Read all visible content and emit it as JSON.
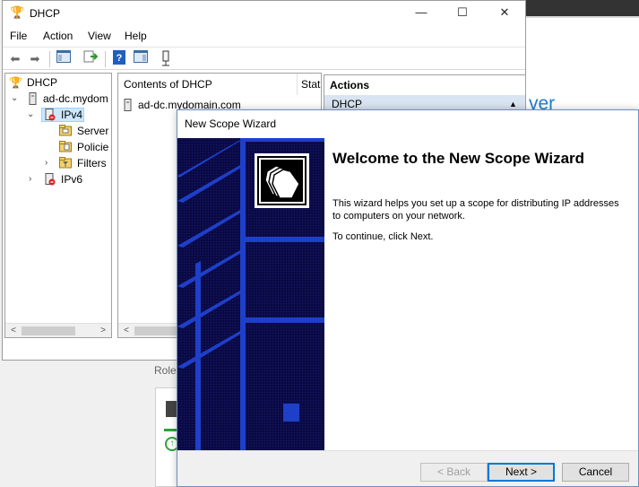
{
  "background_window": {
    "partial_heading": "ver",
    "roles_label": "Roles"
  },
  "dhcp_window": {
    "title": "DHCP",
    "menu": [
      "File",
      "Action",
      "View",
      "Help"
    ],
    "window_buttons": {
      "minimize": "—",
      "maximize": "☐",
      "close": "✕"
    },
    "tree": {
      "items": [
        {
          "label": "DHCP",
          "expander": ""
        },
        {
          "label": "ad-dc.mydom",
          "expander": "⌄"
        },
        {
          "label": "IPv4",
          "expander": "⌄"
        },
        {
          "label": "Server",
          "expander": ""
        },
        {
          "label": "Policie",
          "expander": ""
        },
        {
          "label": "Filters",
          "expander": "›"
        },
        {
          "label": "IPv6",
          "expander": "›"
        }
      ]
    },
    "content": {
      "column_header": "Contents of DHCP",
      "column_header_2": "Stat",
      "rows": [
        "ad-dc.mydomain.com"
      ]
    },
    "actions": {
      "header": "Actions",
      "section": "DHCP",
      "section_arrow": "▲"
    },
    "scroll": {
      "left": "<",
      "right": ">"
    }
  },
  "wizard": {
    "title": "New Scope Wizard",
    "heading": "Welcome to the New Scope Wizard",
    "paragraph_1": "This wizard helps you set up a scope for distributing IP addresses to computers on your network.",
    "paragraph_2": "To continue, click Next.",
    "buttons": {
      "back": "< Back",
      "next": "Next >",
      "cancel": "Cancel"
    },
    "banner_color": "#0a0a45",
    "banner_accent": "#1e3fc8"
  }
}
